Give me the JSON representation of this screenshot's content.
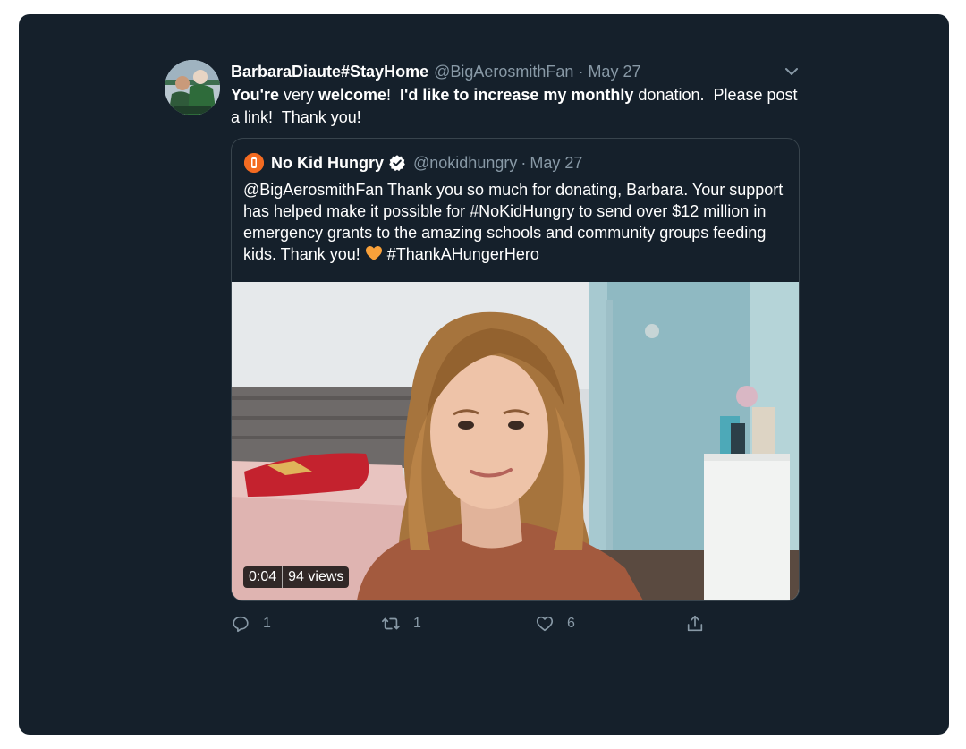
{
  "tweet": {
    "display_name": "BarbaraDiaute#StayHome",
    "handle": "@BigAerosmithFan",
    "separator": "·",
    "date": "May 27",
    "text_parts": {
      "p1": "You're",
      "p2": " very ",
      "p3": "welcome",
      "p4": "!  ",
      "p5": "I'd like to increase my monthly",
      "p6": " donation.  Please post a link!  Thank you!"
    },
    "avatar_icon": "profile-photo",
    "more_icon": "chevron-down-icon"
  },
  "quote": {
    "display_name": "No Kid Hungry",
    "verified_icon": "verified-badge-icon",
    "handle": "@nokidhungry",
    "separator": "·",
    "date": "May 27",
    "text_before": "@BigAerosmithFan Thank you so much for donating, Barbara. Your support has helped make it possible for #NoKidHungry to send over $12 million in emergency grants to the amazing schools and community groups feeding kids. Thank you! ",
    "text_after": " #ThankAHungerHero",
    "emoji": "orange-heart",
    "video": {
      "duration": "0:04",
      "views": "94 views"
    }
  },
  "actions": {
    "reply_count": "1",
    "retweet_count": "1",
    "like_count": "6"
  },
  "colors": {
    "background": "#15202b",
    "border": "#38444d",
    "secondary_text": "#8899a6",
    "primary_text": "#ffffff",
    "brand_orange": "#f46b21",
    "heart_orange": "#f9a13a"
  }
}
